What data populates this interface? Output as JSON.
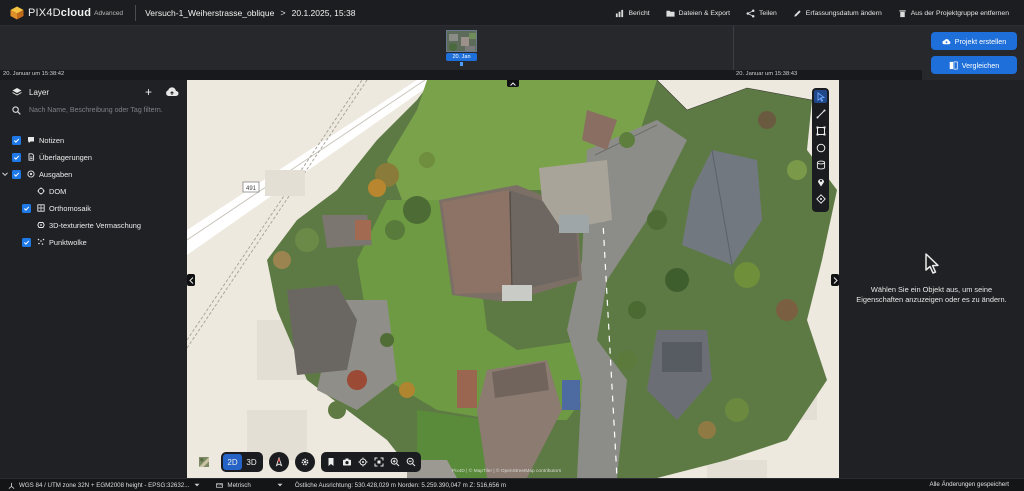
{
  "app": {
    "brand": "PIX4Dcloud",
    "brand_plain": "PIX4D",
    "brand_bold": "cloud",
    "edition": "Advanced",
    "project_name": "Versuch-1_Weiherstrasse_oblique",
    "project_date": "20.1.2025, 15:38",
    "crumb_separator": ">"
  },
  "header_actions": [
    {
      "label": "Bericht",
      "icon": "report-icon"
    },
    {
      "label": "Dateien & Export",
      "icon": "folder-icon"
    },
    {
      "label": "Teilen",
      "icon": "share-icon"
    },
    {
      "label": "Erfassungsdatum ändern",
      "icon": "pencil-icon"
    },
    {
      "label": "Aus der Projektgruppe entfernen",
      "icon": "trash-icon"
    }
  ],
  "timeline": {
    "chip_label": "20. Jan",
    "left_time": "20. Januar um 15:38:42",
    "right_time": "20. Januar um 15:38:43"
  },
  "right_buttons": {
    "create_project": "Projekt erstellen",
    "compare": "Vergleichen"
  },
  "layers": {
    "title": "Layer",
    "add_symbol": "+",
    "search_placeholder": "Nach Name, Beschreibung oder Tag filtern.",
    "items": [
      {
        "label": "Notizen",
        "checked": true,
        "icon": "note-icon"
      },
      {
        "label": "Überlagerungen",
        "checked": true,
        "icon": "overlay-icon"
      },
      {
        "label": "Ausgaben",
        "checked": true,
        "icon": "outputs-icon",
        "expanded": true
      },
      {
        "label": "DOM",
        "checked": false,
        "icon": "dsm-icon"
      },
      {
        "label": "Orthomosaik",
        "checked": true,
        "icon": "orthomosaic-icon"
      },
      {
        "label": "3D-texturierte Vermaschung",
        "checked": false,
        "icon": "mesh-icon"
      },
      {
        "label": "Punktwolke",
        "checked": true,
        "icon": "pointcloud-icon"
      }
    ]
  },
  "map": {
    "road_label": "491",
    "mode_2d": "2D",
    "mode_3d": "3D",
    "active_mode": "2D",
    "attribution": "Pix4D | © MapTiler | © OpenStreetMap contributors"
  },
  "properties_panel": {
    "hint_line1": "Wählen Sie ein Objekt aus, um seine",
    "hint_line2": "Eigenschaften anzuzeigen oder es zu ändern."
  },
  "statusbar": {
    "crs": "WGS 84 / UTM zone 32N + EGM2008 height - EPSG:32632...",
    "units": "Metrisch",
    "coordinates": "Östliche Ausrichtung: 530.428,029 m  Norden: 5.259.390,047 m  Z: 516,656 m",
    "save_state": "Alle Änderungen gespeichert"
  },
  "colors": {
    "accent": "#1e6fd9",
    "checkbox": "#1e78e6",
    "panel": "#1f2124",
    "topbar": "#1c1d20"
  }
}
